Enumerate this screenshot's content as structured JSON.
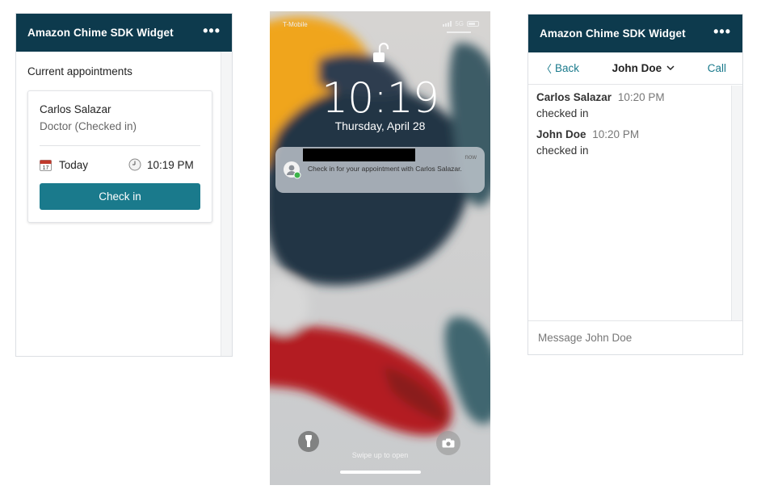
{
  "left_widget": {
    "title": "Amazon Chime SDK Widget",
    "more_label": "•••",
    "section_heading": "Current appointments",
    "appointment": {
      "name": "Carlos Salazar",
      "role": "Doctor (Checked in)",
      "date": "Today",
      "time": "10:19 PM",
      "checkin_label": "Check in"
    }
  },
  "phone": {
    "carrier": "T-Mobile",
    "network": "5G",
    "time": "10:19",
    "date": "Thursday, April 28",
    "notification": {
      "time": "now",
      "text": "Check in for your appointment with Carlos Salazar."
    },
    "swipe_text": "Swipe up to open"
  },
  "right_widget": {
    "title": "Amazon Chime SDK Widget",
    "more_label": "•••",
    "back_label": "Back",
    "contact_name": "John Doe",
    "call_label": "Call",
    "messages": [
      {
        "sender": "Carlos Salazar",
        "time": "10:20 PM",
        "body": "checked in"
      },
      {
        "sender": "John Doe",
        "time": "10:20 PM",
        "body": "checked in"
      }
    ],
    "composer_placeholder": "Message John Doe"
  },
  "colors": {
    "header_bg": "#0d3a4d",
    "accent": "#1a7a8c"
  }
}
